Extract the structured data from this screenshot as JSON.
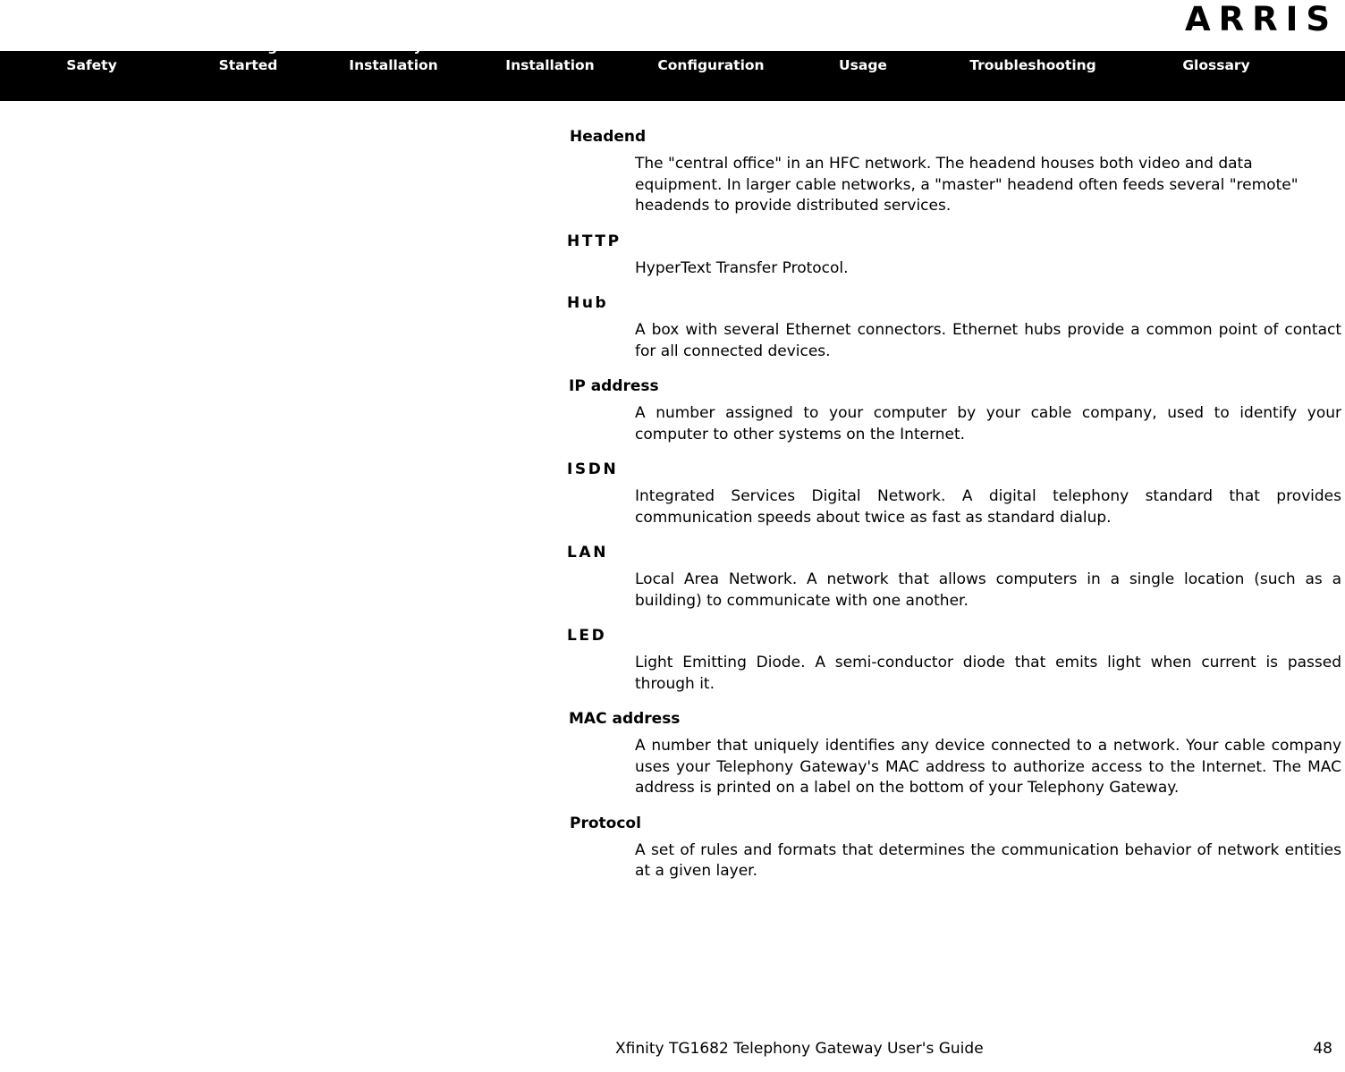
{
  "brand": {
    "logo_text": "ARRIS"
  },
  "navbar": {
    "items": [
      {
        "label": "Safety"
      },
      {
        "label": "Getting\nStarted"
      },
      {
        "label": "Battery\nInstallation"
      },
      {
        "label": "Installation"
      },
      {
        "label": "Ethernet\nConfiguration"
      },
      {
        "label": "Usage"
      },
      {
        "label": "Troubleshooting"
      },
      {
        "label": "Glossary"
      }
    ]
  },
  "glossary": {
    "entries": [
      {
        "term": "Headend",
        "definition": "The \"central office\" in an HFC network. The headend houses both video and data equipment. In larger cable networks, a \"master\" headend often feeds several \"remote\" headends to provide distributed services."
      },
      {
        "term": "HTTP",
        "definition": "HyperText Transfer Protocol."
      },
      {
        "term": "Hub",
        "definition": "A box with several Ethernet connectors. Ethernet hubs provide a common point of contact for all connected devices."
      },
      {
        "term": "IP address",
        "definition": "A number assigned to your computer by your cable company, used to identify your computer to other systems on the Internet."
      },
      {
        "term": "ISDN",
        "definition": "Integrated Services Digital Network. A digital telephony standard that provides communication speeds about twice as fast as standard dialup."
      },
      {
        "term": "LAN",
        "definition": "Local Area Network. A network that allows computers in a single location (such as a building) to communicate with one another."
      },
      {
        "term": "LED",
        "definition": "Light Emitting Diode. A semi-conductor diode that emits light when current is passed through it."
      },
      {
        "term": "MAC address",
        "definition": "A number that uniquely identifies any device connected to a network. Your cable company uses your Telephony Gateway's MAC address to authorize access to the Internet. The MAC address is printed on a label on the bottom of your Telephony Gateway."
      },
      {
        "term": "Protocol",
        "definition": "A set of rules and formats that determines the communication behavior of network entities at a given layer."
      }
    ]
  },
  "footer": {
    "title": "Xfinity TG1682 Telephony Gateway User's Guide",
    "page_number": "48"
  }
}
